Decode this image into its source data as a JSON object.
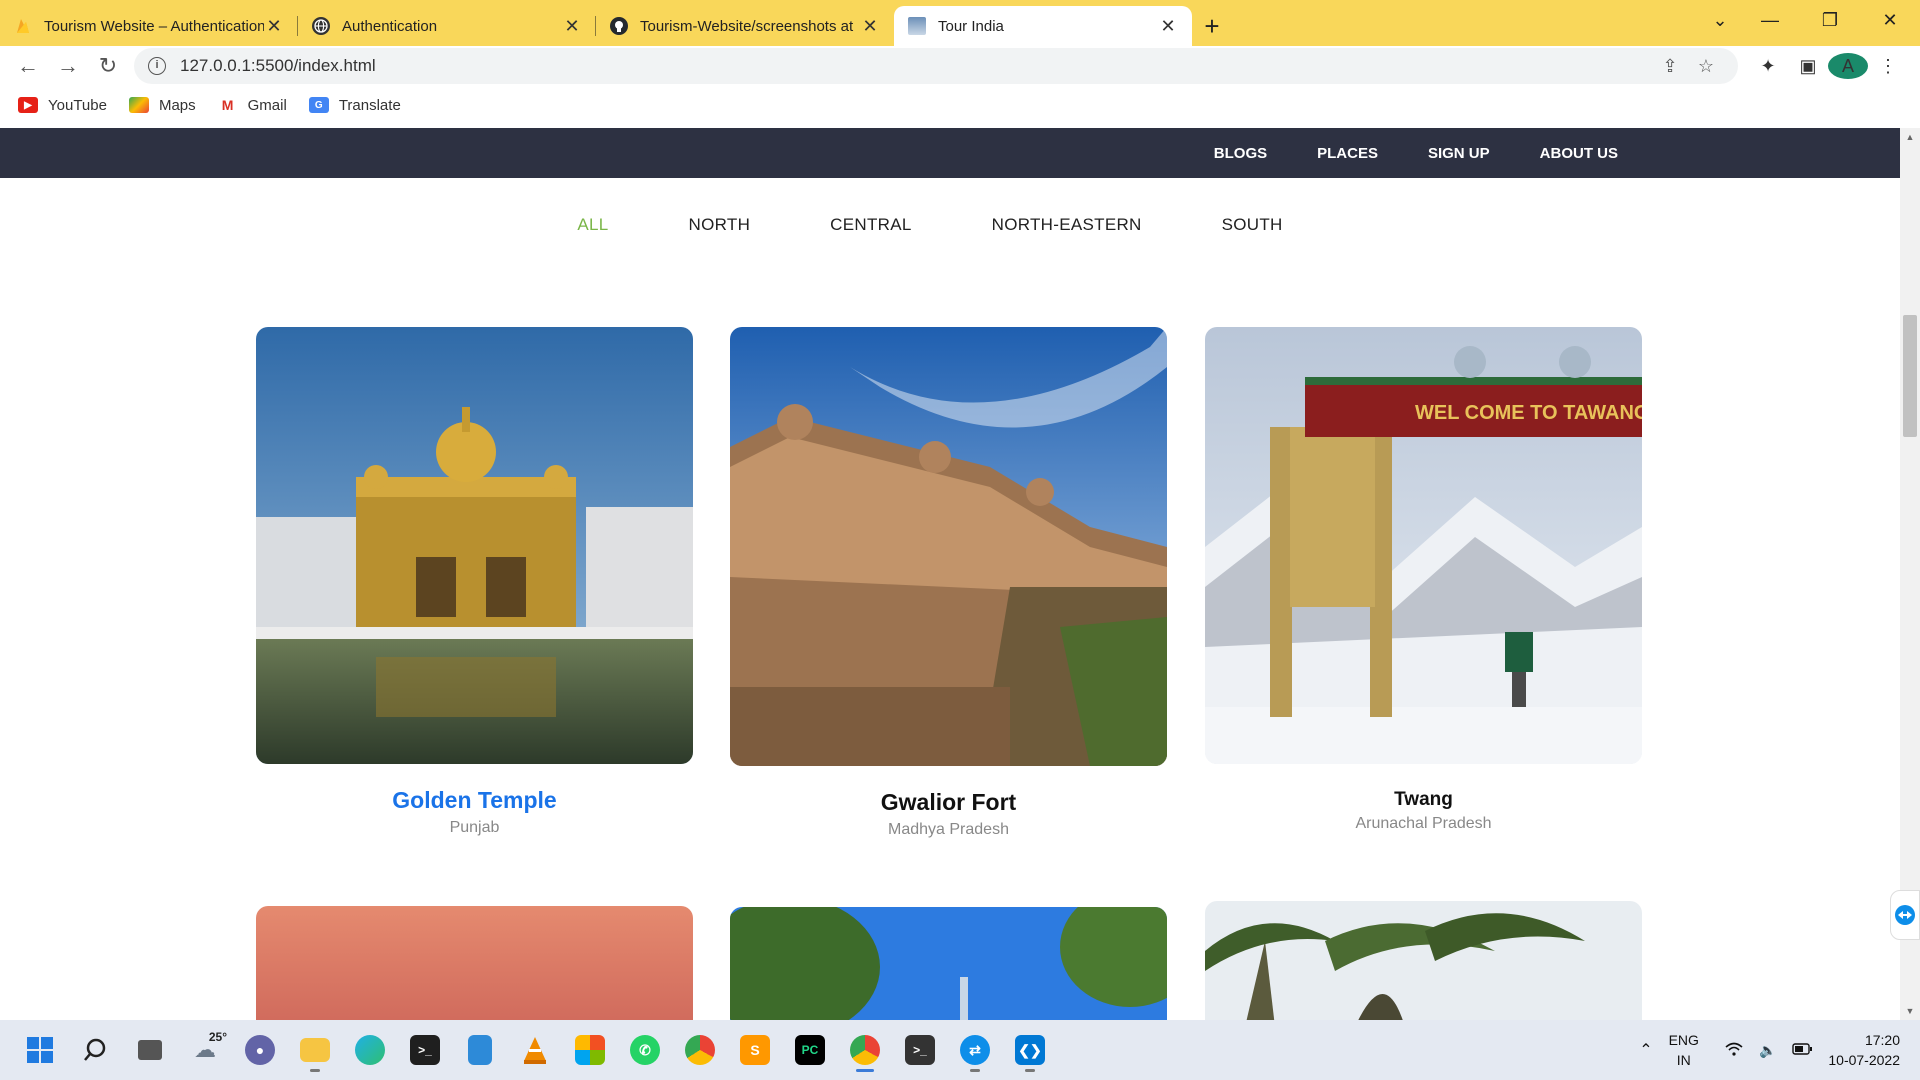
{
  "browser": {
    "tabs": [
      {
        "title": "Tourism Website – Authentication",
        "favicon": "firebase-icon",
        "color": "#f5a623"
      },
      {
        "title": "Authentication",
        "favicon": "globe-icon",
        "color": "#333333"
      },
      {
        "title": "Tourism-Website/screenshots at",
        "favicon": "github-icon",
        "color": "#24292e"
      },
      {
        "title": "Tour India",
        "favicon": "page-thumbnail-icon",
        "color": "#6b8fb8"
      }
    ],
    "new_tab": "+",
    "address": "127.0.0.1:5500/index.html",
    "bookmarks": [
      {
        "label": "YouTube",
        "icon": "youtube-icon",
        "color": "#e62117"
      },
      {
        "label": "Maps",
        "icon": "maps-icon",
        "color": "#34a853"
      },
      {
        "label": "Gmail",
        "icon": "gmail-icon",
        "color": "#d93025"
      },
      {
        "label": "Translate",
        "icon": "translate-icon",
        "color": "#4285f4"
      }
    ],
    "profile_initial": "A"
  },
  "site": {
    "nav": [
      "BLOGS",
      "PLACES",
      "SIGN UP",
      "ABOUT US"
    ],
    "filters": [
      "ALL",
      "NORTH",
      "CENTRAL",
      "NORTH-EASTERN",
      "SOUTH"
    ],
    "active_filter": "ALL",
    "places": [
      {
        "name": "Golden Temple",
        "state": "Punjab"
      },
      {
        "name": "Gwalior Fort",
        "state": "Madhya Pradesh"
      },
      {
        "name": "Twang",
        "state": "Arunachal Pradesh"
      }
    ],
    "twang_sign": "WEL COME TO TAWANG",
    "colors": {
      "nav_bg": "#2d3142",
      "active_filter": "#7ab648",
      "highlight_title": "#1a73e8"
    }
  },
  "taskbar": {
    "weather": "25°",
    "tray": {
      "lang": "ENG",
      "region": "IN",
      "time": "17:20",
      "date": "10-07-2022"
    }
  }
}
